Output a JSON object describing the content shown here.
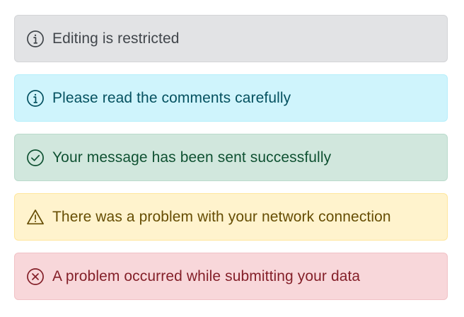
{
  "alerts": [
    {
      "variant": "secondary",
      "icon": "info-icon",
      "text": "Editing is restricted",
      "bg": "#e2e3e5",
      "fg": "#41464b"
    },
    {
      "variant": "info",
      "icon": "info-icon",
      "text": "Please read the comments carefully",
      "bg": "#cff4fc",
      "fg": "#055160"
    },
    {
      "variant": "success",
      "icon": "check-circle-icon",
      "text": "Your message has been sent successfully",
      "bg": "#d1e7dd",
      "fg": "#0f5132"
    },
    {
      "variant": "warning",
      "icon": "warning-triangle-icon",
      "text": "There was a problem with your network connection",
      "bg": "#fff3cd",
      "fg": "#664d03"
    },
    {
      "variant": "danger",
      "icon": "x-circle-icon",
      "text": "A problem occurred while submitting your data",
      "bg": "#f8d7da",
      "fg": "#842029"
    }
  ]
}
